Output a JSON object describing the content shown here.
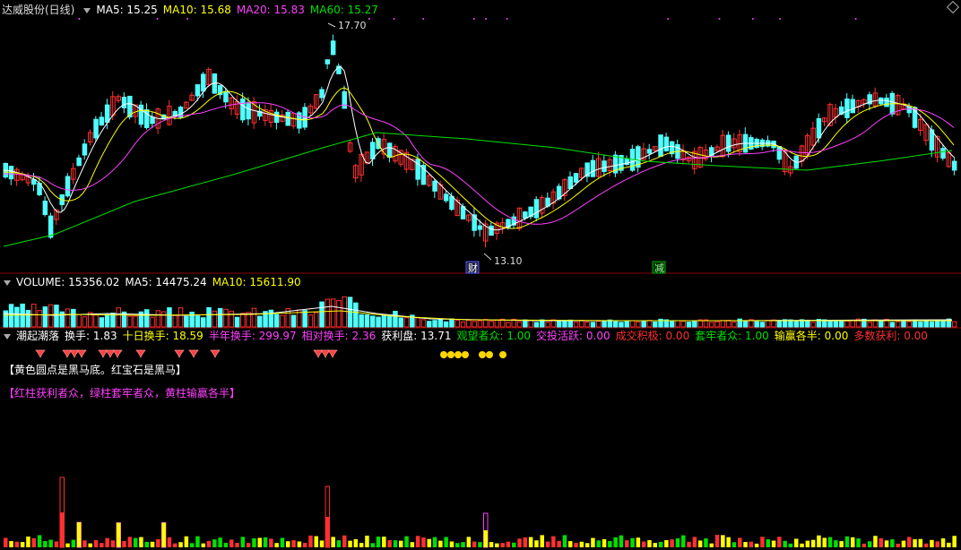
{
  "price_header": {
    "stock": "达威股份(日线)",
    "ma5": "MA5: 15.25",
    "ma10": "MA10: 15.68",
    "ma20": "MA20: 15.83",
    "ma60": "MA60: 15.27"
  },
  "price_annotations": {
    "high": "17.70",
    "low": "13.10",
    "tag_cai": "财",
    "tag_jian": "减"
  },
  "volume_header": {
    "label": "VOLUME: 15356.02",
    "ma5": "MA5: 14475.24",
    "ma10": "MA10: 15611.90"
  },
  "indicator_header": {
    "name": "潮起潮落",
    "items": [
      {
        "text": "换手: 1.83",
        "color": "#ffffff"
      },
      {
        "text": "十日换手: 18.59",
        "color": "#ffff00"
      },
      {
        "text": "半年换手: 299.97",
        "color": "#ff40ff"
      },
      {
        "text": "相对换手: 2.36",
        "color": "#ff40ff"
      },
      {
        "text": "获利盘: 13.71",
        "color": "#ffffff"
      },
      {
        "text": "观望者众: 1.00",
        "color": "#00e000"
      },
      {
        "text": "交投活跃: 0.00",
        "color": "#ff40ff"
      },
      {
        "text": "成交积极: 0.00",
        "color": "#ff3030"
      },
      {
        "text": "套牢者众: 1.00",
        "color": "#00e000"
      },
      {
        "text": "输赢各半: 0.00",
        "color": "#ffff00"
      },
      {
        "text": "多数获利: 0.00",
        "color": "#ff3030"
      }
    ]
  },
  "notes": {
    "line1": "【黄色圆点是黑马底。红宝石是黑马】",
    "line2": "【红柱获利者众，绿柱套牢者众，黄柱输赢各半】"
  },
  "colors": {
    "up": "#ff3030",
    "down": "#50ffff",
    "ma5": "#ffffff",
    "ma10": "#ffff00",
    "ma20": "#ff40ff",
    "ma60": "#00e000"
  }
}
